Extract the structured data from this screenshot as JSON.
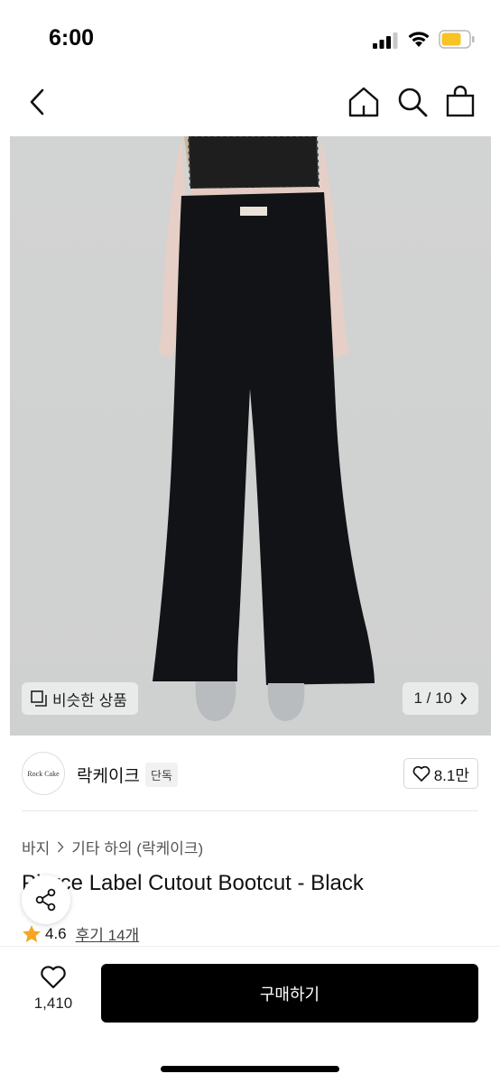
{
  "status_bar": {
    "time": "6:00"
  },
  "product_image": {
    "similar_label": "비슷한 상품",
    "pager": "1 / 10"
  },
  "brand": {
    "logo_text": "Rock Cake",
    "name": "락케이크",
    "tag": "단독",
    "likes": "8.1만"
  },
  "breadcrumb": [
    "바지",
    "기타 하의 (락케이크)"
  ],
  "product": {
    "title": "Pierce Label Cutout Bootcut - Black",
    "rating": "4.6",
    "reviews": "후기 14개"
  },
  "bottom_bar": {
    "like_count": "1,410",
    "buy_label": "구매하기"
  },
  "colors": {
    "accent_star": "#f5a623",
    "buy_button": "#000000",
    "battery": "#f7c325"
  }
}
